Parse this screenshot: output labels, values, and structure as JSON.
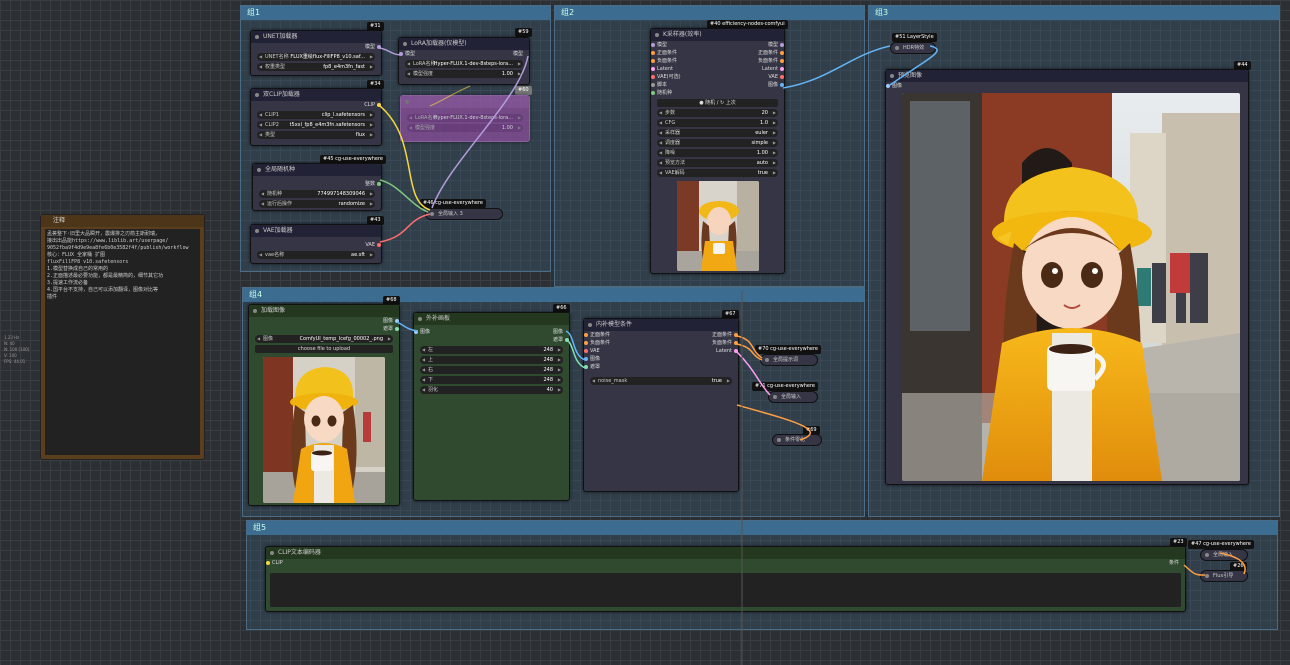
{
  "groups": [
    {
      "id": "g1",
      "label": "组1"
    },
    {
      "id": "g2",
      "label": "组2"
    },
    {
      "id": "g3",
      "label": "组3"
    },
    {
      "id": "g4",
      "label": "组4"
    },
    {
      "id": "g5",
      "label": "组5"
    }
  ],
  "note": {
    "title": "注释",
    "lines": [
      "孟荟整下·旧里大品瞬开，震爆排之刃箭主斯耐瑞，",
      "接出出品能https://www.liblib.art/userpage/",
      "9052fba9f4d9e9ea8fe6b0e3582f4f/publish/workflow",
      "核心：FLUX 全家桶 扩图",
      "fluxFillFP8 v10.safetensors",
      "1.模型替换成自己的常用的",
      "2.正面描述最必要功能，都是最精简的，细节其它功",
      "3.提速工作流必备",
      "4.国平台不支持，自己可以添加翻译，图像对比等",
      "插件"
    ]
  },
  "side_readout": [
    "1.23 Hz",
    "N: 40",
    "N: 100 [100]",
    "V: 100",
    "FPS: 44.01"
  ],
  "nodes": {
    "unet": {
      "badge": "#31",
      "title": "UNET加载器",
      "out": "模型",
      "w1_label": "UNET名称",
      "w1_value": "FLUX重绘flux-FillFP8_v10.saf...",
      "w2_label": "权重类型",
      "w2_value": "fp8_e4m3fn_fast"
    },
    "lora": {
      "badge": "#59",
      "title": "LoRA加载器(仅模型)",
      "in": "模型",
      "out": "模型",
      "w1_label": "LoRA名称",
      "w1_value": "Hyper-FLUX.1-dev-8steps-lora...",
      "w2_label": "模型强度",
      "w2_value": "1.00"
    },
    "lora_bypass": {
      "badge": "#60",
      "w1_label": "LoRA名称",
      "w1_value": "Hyper-FLUX.1-dev-8steps-lora...",
      "w2_label": "模型强度",
      "w2_value": "1.00"
    },
    "dualclip": {
      "badge": "#34",
      "title": "双CLIP加载器",
      "out": "CLIP",
      "w1_label": "CLIP1",
      "w1_value": "clip_l.safetensors",
      "w2_label": "CLIP2",
      "w2_value": "t5xxl_fp8_e4m3fn.safetensors",
      "w3_label": "类型",
      "w3_value": "flux"
    },
    "seed": {
      "badge": "#45 cg-use-everywhere",
      "title": "全局随机种",
      "out": "整数",
      "w1_label": "随机种",
      "w1_value": "774997148309046",
      "w2_label": "运行后操作",
      "w2_value": "randomize"
    },
    "vae": {
      "badge": "#43",
      "title": "VAE加载器",
      "out": "VAE",
      "w1_label": "vae名称",
      "w1_value": "ae.sft"
    },
    "anyin1": {
      "badge": "#46 cg-use-everywhere",
      "title": "全局输入 3"
    },
    "ksampler": {
      "badge": "#40 efficiency-nodes-comfyui",
      "title": "K采样器(效率)",
      "ports": [
        {
          "in": "模型",
          "out": "模型"
        },
        {
          "in": "正面条件",
          "out": "正面条件"
        },
        {
          "in": "负面条件",
          "out": "负面条件"
        },
        {
          "in": "Latent",
          "out": "Latent"
        },
        {
          "in": "VAE(可选)",
          "out": "VAE"
        },
        {
          "in": "脚本",
          "out": "图像"
        },
        {
          "in": "随机种",
          "out": ""
        }
      ],
      "seed_btn": "● 随机 / ↻ 上次",
      "widgets": [
        {
          "l": "步数",
          "v": "20"
        },
        {
          "l": "CFG",
          "v": "1.0"
        },
        {
          "l": "采样器",
          "v": "euler"
        },
        {
          "l": "调度器",
          "v": "simple"
        },
        {
          "l": "降噪",
          "v": "1.00"
        },
        {
          "l": "预览方法",
          "v": "auto"
        },
        {
          "l": "VAE解码",
          "v": "true"
        }
      ]
    },
    "hdr": {
      "badge": "#51 LayerStyle",
      "title": "HDR特效"
    },
    "preview": {
      "badge": "#44",
      "title": "预览图像",
      "in": "图像"
    },
    "loadimg": {
      "badge": "#68",
      "title": "加载图像",
      "out1": "图像",
      "out2": "遮罩",
      "w1_label": "图像",
      "w1_value": "ComfyUI_temp_lcefg_00002_.png",
      "upload": "choose file to upload"
    },
    "pad": {
      "badge": "#66",
      "title": "外补画板",
      "in": "图像",
      "out1": "图像",
      "out2": "遮罩",
      "widgets": [
        {
          "l": "左",
          "v": "248"
        },
        {
          "l": "上",
          "v": "248"
        },
        {
          "l": "右",
          "v": "248"
        },
        {
          "l": "下",
          "v": "248"
        },
        {
          "l": "羽化",
          "v": "40"
        }
      ]
    },
    "inpaint": {
      "badge": "#67",
      "title": "内补模型条件",
      "ins": [
        "正面条件",
        "负面条件",
        "VAE",
        "图像",
        "遮罩"
      ],
      "outs": [
        "正面条件",
        "负面条件",
        "Latent"
      ],
      "w1_label": "noise_mask",
      "w1_value": "true"
    },
    "anyout70": {
      "badge": "#70 cg-use-everywhere",
      "title": "全局提示词"
    },
    "anyout71": {
      "badge": "#71 cg-use-everywhere",
      "title": "全局输入"
    },
    "cond69": {
      "badge": "#69",
      "title": "条件零化"
    },
    "cliptext": {
      "badge": "#23",
      "title": "CLIP文本编码器",
      "in": "CLIP",
      "out": "条件"
    },
    "anyin47": {
      "badge": "#47 cg-use-everywhere",
      "title": "全局输入"
    },
    "guidance": {
      "badge": "#26",
      "title": "Flux引导"
    }
  }
}
